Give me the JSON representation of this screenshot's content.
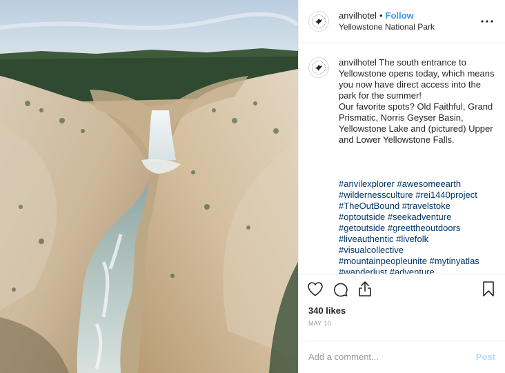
{
  "header": {
    "username": "anvilhotel",
    "dot": "•",
    "follow_label": "Follow",
    "location": "Yellowstone National Park",
    "more_label": "•••"
  },
  "caption": {
    "username": "anvilhotel",
    "lines": [
      "The south entrance to Yellowstone opens today, which means you now have direct access into the park for the summer!",
      "Our favorite spots? Old Faithful, Grand Prismatic, Norris Geyser Basin, Yellowstone Lake and (pictured) Upper and Lower Yellowstone Falls."
    ],
    "hashtags": [
      "#anvilexplorer #awesomeearth",
      "#wildernessculture #rei1440project",
      "#TheOutBound #travelstoke",
      "#optoutside #seekadventure",
      "#getoutside #greettheoutdoors",
      "#liveauthentic #livefolk",
      "#visualcollective",
      "#mountainpeopleunite #mytinyatlas",
      "#wanderlust #adventure"
    ]
  },
  "actions": {
    "like_icon": "heart-icon",
    "comment_icon": "comment-icon",
    "share_icon": "share-icon",
    "save_icon": "bookmark-icon"
  },
  "likes": "340 likes",
  "date": "MAY 10",
  "comment": {
    "placeholder": "Add a comment...",
    "post_label": "Post"
  },
  "colors": {
    "follow": "#3897f0",
    "hashtag": "#003569",
    "post_disabled": "#b2dffc",
    "muted": "#999999"
  },
  "photo": {
    "subject": "canyon-waterfall-photo"
  }
}
